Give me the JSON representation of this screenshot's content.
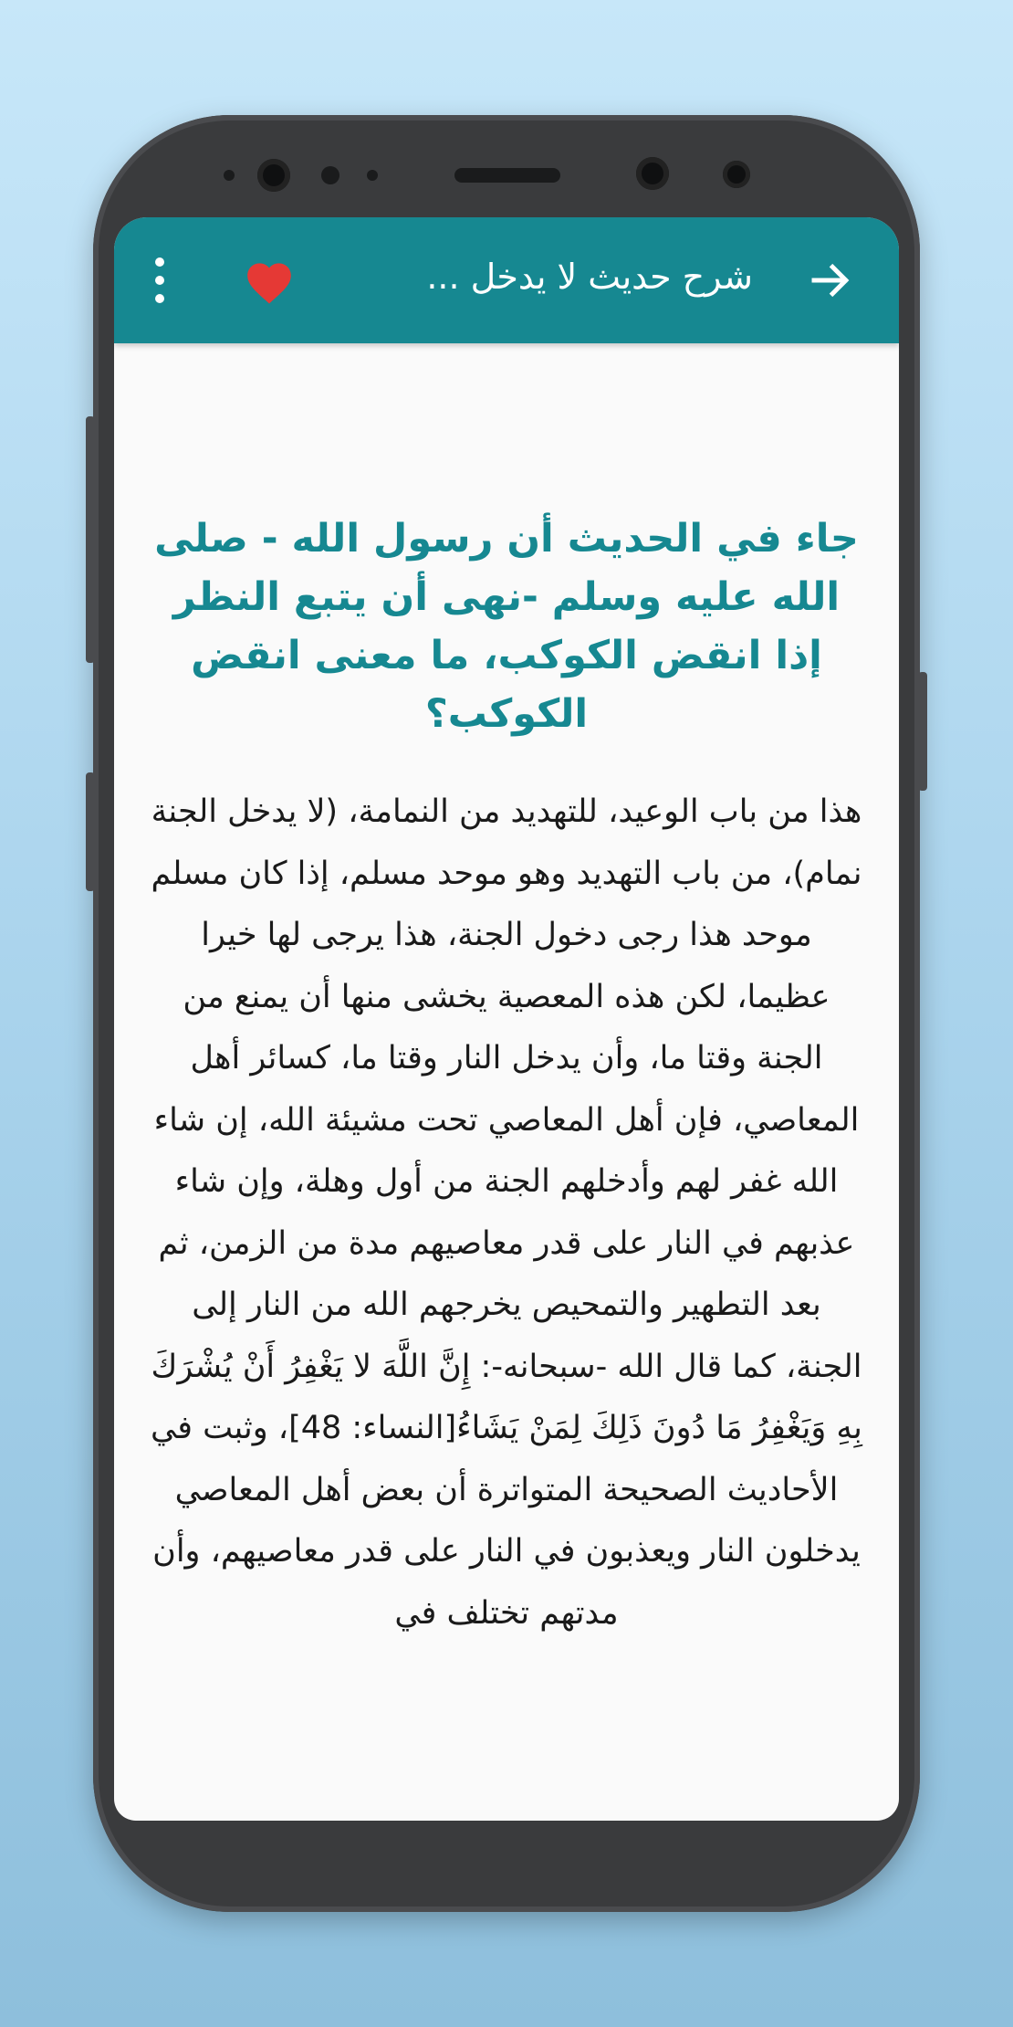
{
  "app_bar": {
    "title": "شرح حديث لا يدخل ...",
    "menu_icon": "more-vert-icon",
    "favorite_icon": "heart-icon",
    "back_icon": "arrow-back-icon"
  },
  "colors": {
    "app_bar": "#168891",
    "heading": "#168891",
    "favorite": "#e53935",
    "body_text": "#1a1a1a",
    "page_background": "#fafafa"
  },
  "article": {
    "question": "جاء في الحديث أن رسول الله - صلى الله عليه وسلم -نهى أن يتبع النظر إذا انقض الكوكب، ما معنى انقض الكوكب؟",
    "answer": "هذا من باب الوعيد، للتهديد من النمامة، (لا يدخل الجنة نمام)، من باب التهديد وهو موحد مسلم، إذا كان مسلم موحد هذا رجى دخول الجنة، هذا يرجى لها خيرا عظيما، لكن هذه المعصية يخشى منها أن يمنع من الجنة وقتا ما، وأن يدخل النار وقتا ما، كسائر أهل المعاصي، فإن أهل المعاصي تحت مشيئة الله، إن شاء الله غفر لهم وأدخلهم الجنة من أول وهلة، وإن شاء عذبهم في النار على قدر معاصيهم مدة من الزمن، ثم بعد التطهير والتمحيص يخرجهم الله من النار إلى الجنة، كما قال الله -سبحانه-: إِنَّ اللَّهَ لا يَغْفِرُ أَنْ يُشْرَكَ بِهِ وَيَغْفِرُ مَا دُونَ ذَلِكَ لِمَنْ يَشَاءُ[النساء: 48]، وثبت في الأحاديث الصحيحة المتواترة أن بعض أهل المعاصي يدخلون النار ويعذبون في النار على قدر معاصيهم، وأن مدتهم تختلف في"
  }
}
